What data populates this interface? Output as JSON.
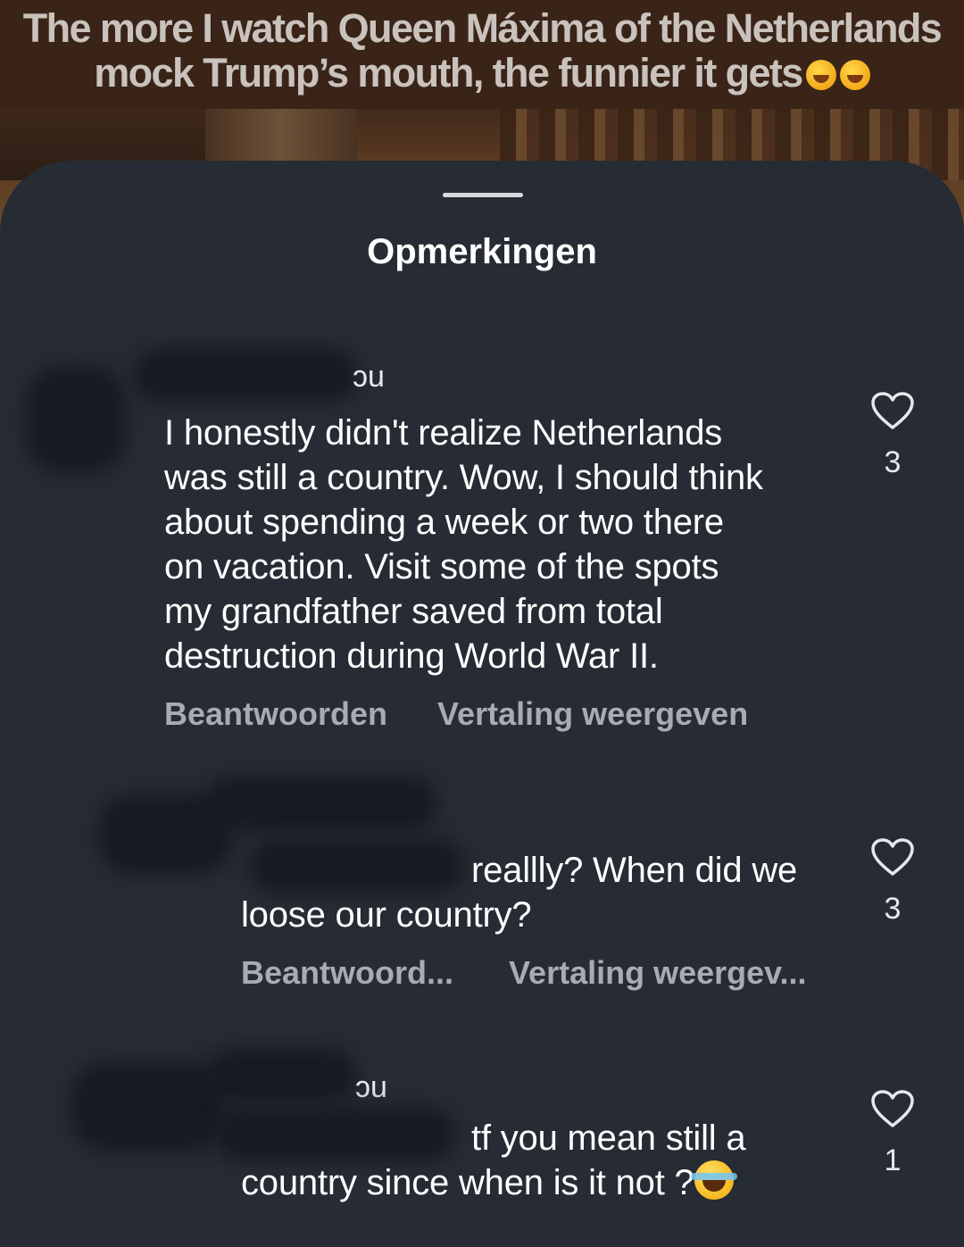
{
  "video": {
    "caption_line1": "The more I watch Queen Máxima of the Netherlands",
    "caption_line2": "mock Trump’s mouth, the funnier it gets"
  },
  "sheet": {
    "title": "Opmerkingen"
  },
  "comments": [
    {
      "username_fragment": "ɔu",
      "text": "I honestly didn't realize Netherlands was still a country. Wow, I should think about spending a week or two there on vacation. Visit some of the spots my grandfather saved from total destruction during World War II.",
      "lines": [
        "I honestly didn't realize Netherlands",
        "was still a country. Wow, I should think",
        "about spending a week or two there",
        "on vacation. Visit some of the spots",
        "my grandfather saved from total",
        "destruction during World War II."
      ],
      "reply_label": "Beantwoorden",
      "translate_label": "Vertaling weergeven",
      "likes": "3"
    },
    {
      "username_fragment": "",
      "lines": [
        "reallly? When did we",
        "loose our country?"
      ],
      "reply_label": "Beantwoord...",
      "translate_label": "Vertaling weergev...",
      "likes": "3"
    },
    {
      "username_fragment": "ɔu",
      "lines": [
        "tf you mean still a",
        "country since when is it not ?"
      ],
      "emoji": "laughing-tears-emoji",
      "likes": "1"
    }
  ],
  "colors": {
    "sheet_bg": "#262b34",
    "text_primary": "#ffffff",
    "text_secondary": "#a6acb5"
  }
}
